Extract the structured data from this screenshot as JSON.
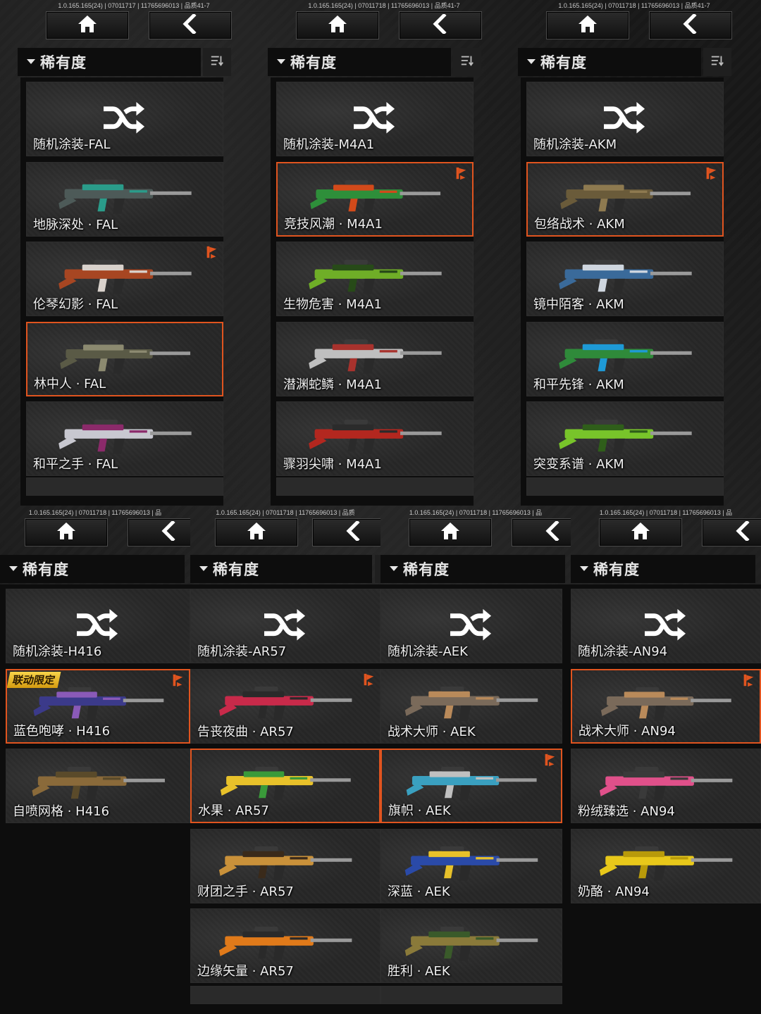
{
  "filter_label": "稀有度",
  "colors": {
    "accent": "#e0541f",
    "card_bg": "#2a2a2a",
    "text": "#f0f0f0",
    "badge": "#f2c12e"
  },
  "icons": {
    "home": "home-icon",
    "back": "back-arrow-icon",
    "shuffle": "shuffle-icon",
    "sort": "sort-icon",
    "flag": "exclusive-flag-icon",
    "dropdown": "chevron-down-icon"
  },
  "panels": [
    {
      "version": "1.0.165.165(24) | 07011717 | 11765696013 | 品质41-7",
      "cards": [
        {
          "name": "随机涂装-FAL",
          "random": true
        },
        {
          "name": "地脉深处 · FAL",
          "palette": [
            "#4d5a58",
            "#2a9c8a"
          ]
        },
        {
          "name": "伦琴幻影 · FAL",
          "palette": [
            "#a74622",
            "#d9d2cc"
          ],
          "flag": true
        },
        {
          "name": "林中人 · FAL",
          "palette": [
            "#5a5a46",
            "#8c8a70"
          ],
          "selected": true
        },
        {
          "name": "和平之手 · FAL",
          "palette": [
            "#c8c8d0",
            "#8b2a6a"
          ]
        }
      ]
    },
    {
      "version": "1.0.165.165(24) | 07011718 | 11765696013 | 品质41-7",
      "cards": [
        {
          "name": "随机涂装-M4A1",
          "random": true
        },
        {
          "name": "竞技风潮 · M4A1",
          "palette": [
            "#2e8f3a",
            "#d24a1a"
          ],
          "selected": true,
          "flag": true
        },
        {
          "name": "生物危害 · M4A1",
          "palette": [
            "#6fae27",
            "#274a18"
          ]
        },
        {
          "name": "潜渊蛇鳞 · M4A1",
          "palette": [
            "#bfbfbf",
            "#a8322d"
          ]
        },
        {
          "name": "骤羽尖啸 · M4A1",
          "palette": [
            "#b3271f",
            "#2b2b2b"
          ]
        }
      ]
    },
    {
      "version": "1.0.165.165(24) | 07011718 | 11765696013 | 品质41-7",
      "cards": [
        {
          "name": "随机涂装-AKM",
          "random": true
        },
        {
          "name": "包络战术 · AKM",
          "palette": [
            "#6a5b3a",
            "#8e7a50"
          ],
          "selected": true,
          "flag": true
        },
        {
          "name": "镜中陌客 · AKM",
          "palette": [
            "#3a6a9a",
            "#cfd6df"
          ]
        },
        {
          "name": "和平先锋 · AKM",
          "palette": [
            "#2f8a3a",
            "#1e9ad6"
          ]
        },
        {
          "name": "突变系谱 · AKM",
          "palette": [
            "#78c42a",
            "#2f5e1a"
          ]
        }
      ]
    },
    {
      "version": "1.0.165.165(24) | 07011718 | 11765696013 | 品",
      "cards": [
        {
          "name": "随机涂装-H416",
          "random": true
        },
        {
          "name": "蓝色咆哮 · H416",
          "palette": [
            "#3b3a8a",
            "#8a5ab8"
          ],
          "selected": true,
          "flag": true,
          "badge": "联动限定"
        },
        {
          "name": "自喷网格 · H416",
          "palette": [
            "#8a6a3a",
            "#5a4a2a"
          ]
        }
      ]
    },
    {
      "version": "1.0.165.165(24) | 07011718 | 11765696013 | 品质",
      "cards": [
        {
          "name": "随机涂装-AR57",
          "random": true
        },
        {
          "name": "告丧夜曲 · AR57",
          "palette": [
            "#c82a4a",
            "#2a2a2a"
          ],
          "flag": true
        },
        {
          "name": "水果 · AR57",
          "palette": [
            "#e8c12a",
            "#3a9a3a"
          ],
          "selected": true
        },
        {
          "name": "财团之手 · AR57",
          "palette": [
            "#c9913a",
            "#3a2a1a"
          ]
        },
        {
          "name": "边缘矢量 · AR57",
          "palette": [
            "#e07a1a",
            "#2a2a2a"
          ]
        }
      ]
    },
    {
      "version": "1.0.165.165(24) | 07011718 | 11765696013 | 品",
      "cards": [
        {
          "name": "随机涂装-AEK",
          "random": true
        },
        {
          "name": "战术大师 · AEK",
          "palette": [
            "#7a6a5a",
            "#b98a5a"
          ]
        },
        {
          "name": "旗帜 · AEK",
          "palette": [
            "#3aa0c0",
            "#c0c0c0"
          ],
          "selected": true,
          "flag": true
        },
        {
          "name": "深蓝 · AEK",
          "palette": [
            "#2a4aa8",
            "#e8c12a"
          ]
        },
        {
          "name": "胜利 · AEK",
          "palette": [
            "#8a7a3a",
            "#3a5a2a"
          ]
        }
      ]
    },
    {
      "version": "1.0.165.165(24) | 07011718 | 11765696013 | 品",
      "cards": [
        {
          "name": "随机涂装-AN94",
          "random": true
        },
        {
          "name": "战术大师 · AN94",
          "palette": [
            "#7a6a5a",
            "#b98a5a"
          ],
          "selected": true,
          "flag": true
        },
        {
          "name": "粉绒臻选 · AN94",
          "palette": [
            "#e0508a",
            "#3a3a3a"
          ]
        },
        {
          "name": "奶酪 · AN94",
          "palette": [
            "#e8c81a",
            "#b89a0a"
          ]
        }
      ]
    }
  ]
}
